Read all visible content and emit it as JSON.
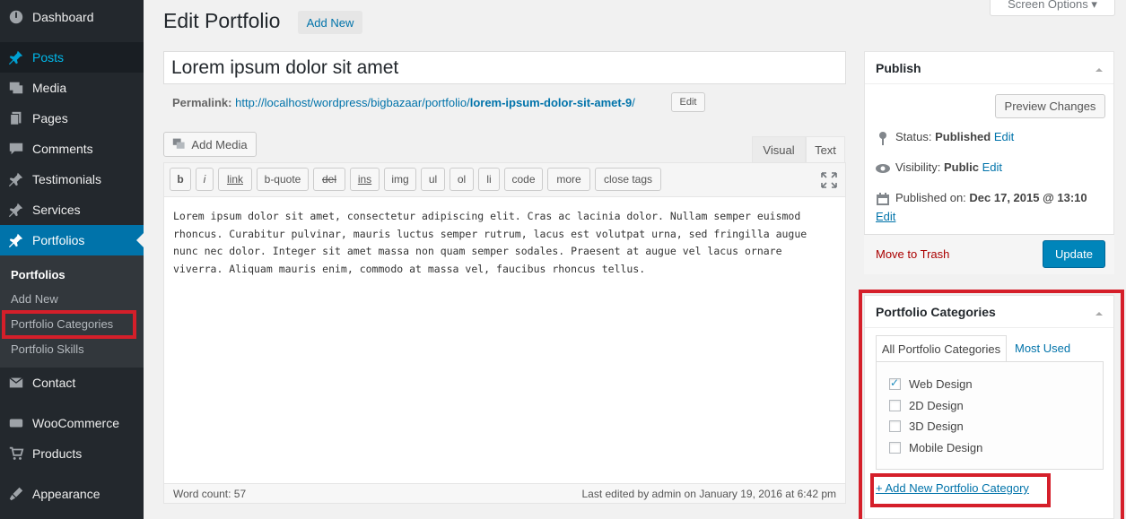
{
  "sidebar": {
    "items": [
      {
        "label": "Dashboard",
        "icon": "dashboard-icon"
      },
      {
        "label": "Posts",
        "icon": "pin-icon"
      },
      {
        "label": "Media",
        "icon": "media-icon"
      },
      {
        "label": "Pages",
        "icon": "pages-icon"
      },
      {
        "label": "Comments",
        "icon": "comments-icon"
      },
      {
        "label": "Testimonials",
        "icon": "pin-icon"
      },
      {
        "label": "Services",
        "icon": "pin-icon"
      },
      {
        "label": "Portfolios",
        "icon": "pin-icon"
      },
      {
        "label": "Contact",
        "icon": "mail-icon"
      },
      {
        "label": "WooCommerce",
        "icon": "woo-icon"
      },
      {
        "label": "Products",
        "icon": "products-icon"
      },
      {
        "label": "Appearance",
        "icon": "appearance-icon"
      }
    ],
    "submenu": [
      "Portfolios",
      "Add New",
      "Portfolio Categories",
      "Portfolio Skills"
    ]
  },
  "header": {
    "title": "Edit Portfolio",
    "add_new": "Add New",
    "screen_options": "Screen Options ▾"
  },
  "post": {
    "title": "Lorem ipsum dolor sit amet",
    "permalink_label": "Permalink:",
    "permalink_base": "http://localhost/wordpress/bigbazaar/portfolio/",
    "permalink_slug": "lorem-ipsum-dolor-sit-amet-9",
    "permalink_end": "/",
    "permalink_edit": "Edit",
    "add_media": "Add Media",
    "tab_visual": "Visual",
    "tab_text": "Text",
    "quicktags": [
      "b",
      "i",
      "link",
      "b-quote",
      "del",
      "ins",
      "img",
      "ul",
      "ol",
      "li",
      "code",
      "more",
      "close tags"
    ],
    "content": "Lorem ipsum dolor sit amet, consectetur adipiscing elit. Cras ac lacinia dolor. Nullam semper euismod rhoncus. Curabitur pulvinar, mauris luctus semper rutrum, lacus est volutpat urna, sed fringilla augue nunc nec dolor. Integer sit amet massa non quam semper sodales. Praesent at augue vel lacus ornare viverra. Aliquam mauris enim, commodo at massa vel, faucibus rhoncus tellus.",
    "word_count": "Word count: 57",
    "last_edited": "Last edited by admin on January 19, 2016 at 6:42 pm"
  },
  "publish": {
    "title": "Publish",
    "preview": "Preview Changes",
    "status_label": "Status:",
    "status_value": "Published",
    "visibility_label": "Visibility:",
    "visibility_value": "Public",
    "published_label": "Published on:",
    "published_value": "Dec 17, 2015 @ 13:10",
    "edit": "Edit",
    "trash": "Move to Trash",
    "update": "Update"
  },
  "categories": {
    "title": "Portfolio Categories",
    "tab_all": "All Portfolio Categories",
    "tab_used": "Most Used",
    "items": [
      {
        "label": "Web Design",
        "checked": true
      },
      {
        "label": "2D Design",
        "checked": false
      },
      {
        "label": "3D Design",
        "checked": false
      },
      {
        "label": "Mobile Design",
        "checked": false
      }
    ],
    "add_new": "+ Add New Portfolio Category"
  }
}
